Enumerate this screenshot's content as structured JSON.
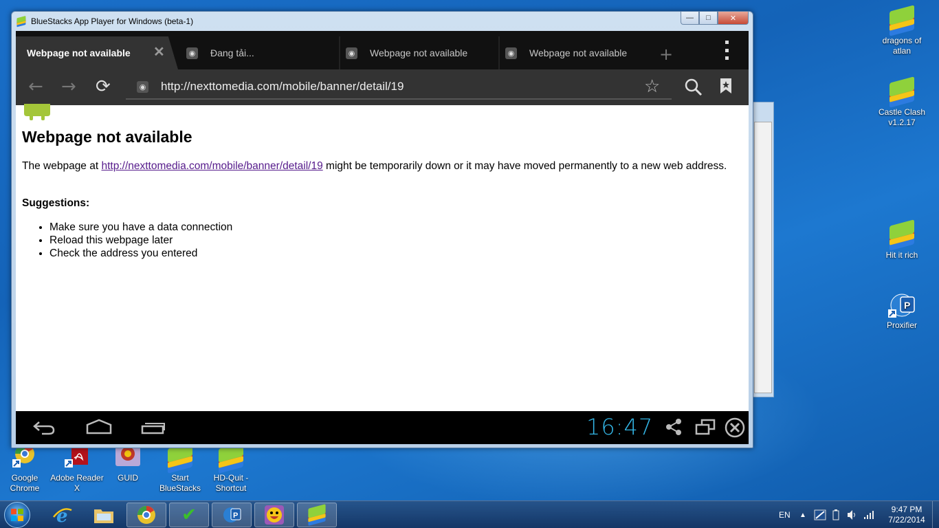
{
  "window": {
    "title": "BlueStacks App Player for Windows (beta-1)",
    "min_glyph": "—",
    "max_glyph": "□",
    "close_glyph": "✕"
  },
  "browser": {
    "tabs": [
      {
        "label": "Webpage not available",
        "active": true
      },
      {
        "label": "Đang tải...",
        "active": false
      },
      {
        "label": "Webpage not available",
        "active": false
      },
      {
        "label": "Webpage not available",
        "active": false
      }
    ],
    "tab_close_glyph": "✕",
    "new_tab_glyph": "+",
    "url": "http://nexttomedia.com/mobile/banner/detail/19"
  },
  "page": {
    "title": "Webpage not available",
    "msg_before": "The webpage at ",
    "msg_link": "http://nexttomedia.com/mobile/banner/detail/19",
    "msg_after": " might be temporarily down or it may have moved permanently to a new web address.",
    "suggestions_title": "Suggestions:",
    "suggestions": [
      "Make sure you have a data connection",
      "Reload this webpage later",
      "Check the address you entered"
    ]
  },
  "android_nav": {
    "clock": "16:47"
  },
  "desktop": {
    "right_icons": [
      {
        "label": "dragons of atlan"
      },
      {
        "label": "Castle Clash v1.2.17"
      },
      {
        "label": "Hit it rich"
      },
      {
        "label": "Proxifier"
      }
    ],
    "bottom_icons": [
      {
        "label": "Google Chrome"
      },
      {
        "label": "Adobe Reader X"
      },
      {
        "label": "GUID"
      },
      {
        "label": "Start BlueStacks"
      },
      {
        "label": "HD-Quit - Shortcut"
      }
    ]
  },
  "taskbar": {
    "language": "EN",
    "time": "9:47 PM",
    "date": "7/22/2014"
  },
  "colors": {
    "android_accent": "#33b5e5",
    "visited_link": "#551a8b"
  }
}
